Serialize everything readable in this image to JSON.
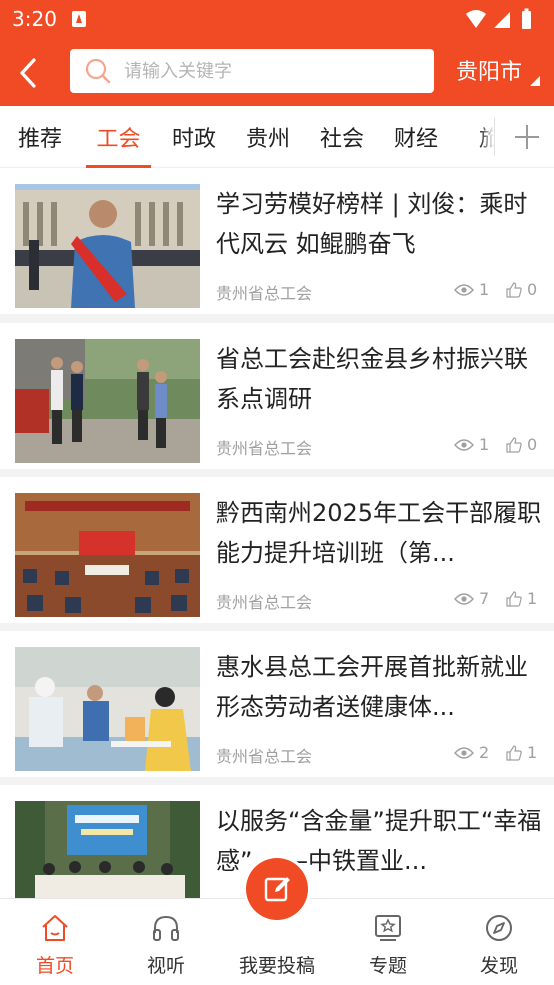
{
  "status_bar": {
    "time": "3:20"
  },
  "header": {
    "search_placeholder": "请输入关键字",
    "city": "贵阳市"
  },
  "tabs": [
    {
      "label": "推荐",
      "active": false
    },
    {
      "label": "工会",
      "active": true
    },
    {
      "label": "时政",
      "active": false
    },
    {
      "label": "贵州",
      "active": false
    },
    {
      "label": "社会",
      "active": false
    },
    {
      "label": "财经",
      "active": false
    },
    {
      "label": "旅",
      "active": false
    }
  ],
  "articles": [
    {
      "title": "学习劳模好榜样 | 刘俊：乘时代风云  如鲲鹏奋飞",
      "source": "贵州省总工会",
      "views": "1",
      "likes": "0"
    },
    {
      "title": "省总工会赴织金县乡村振兴联系点调研",
      "source": "贵州省总工会",
      "views": "1",
      "likes": "0"
    },
    {
      "title": "黔西南州2025年工会干部履职能力提升培训班（第...",
      "source": "贵州省总工会",
      "views": "7",
      "likes": "1"
    },
    {
      "title": "惠水县总工会开展首批新就业形态劳动者送健康体...",
      "source": "贵州省总工会",
      "views": "2",
      "likes": "1"
    },
    {
      "title": "以服务“含金量”提升职工“幸福感” ——中铁置业...",
      "source": "",
      "views": "",
      "likes": ""
    }
  ],
  "bottom_nav": [
    {
      "label": "首页",
      "icon": "home-icon",
      "active": true
    },
    {
      "label": "视听",
      "icon": "headphones-icon",
      "active": false
    },
    {
      "label": "我要投稿",
      "icon": "edit-icon",
      "active": false
    },
    {
      "label": "专题",
      "icon": "star-board-icon",
      "active": false
    },
    {
      "label": "发现",
      "icon": "compass-icon",
      "active": false
    }
  ],
  "colors": {
    "brand": "#f04b24",
    "text": "#222222",
    "muted": "#a0a0a0"
  }
}
